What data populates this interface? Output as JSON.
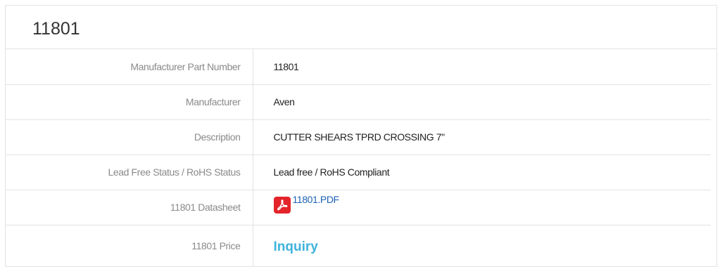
{
  "title": "11801",
  "rows": {
    "part_number": {
      "label": "Manufacturer Part Number",
      "value": "11801"
    },
    "manufacturer": {
      "label": "Manufacturer",
      "value": "Aven"
    },
    "description": {
      "label": "Description",
      "value": "CUTTER SHEARS TPRD CROSSING 7\""
    },
    "rohs": {
      "label": "Lead Free Status / RoHS Status",
      "value": "Lead free / RoHS Compliant"
    },
    "datasheet": {
      "label": "11801 Datasheet",
      "value": "11801.PDF",
      "icon": "pdf-icon"
    },
    "price": {
      "label": "11801 Price",
      "value": "Inquiry"
    }
  },
  "colors": {
    "border": "#e3e3e3",
    "label_text": "#8a8a8a",
    "link_blue": "#1e62b7",
    "inquiry_cyan": "#3fb3dc",
    "pdf_red": "#e3242b"
  }
}
